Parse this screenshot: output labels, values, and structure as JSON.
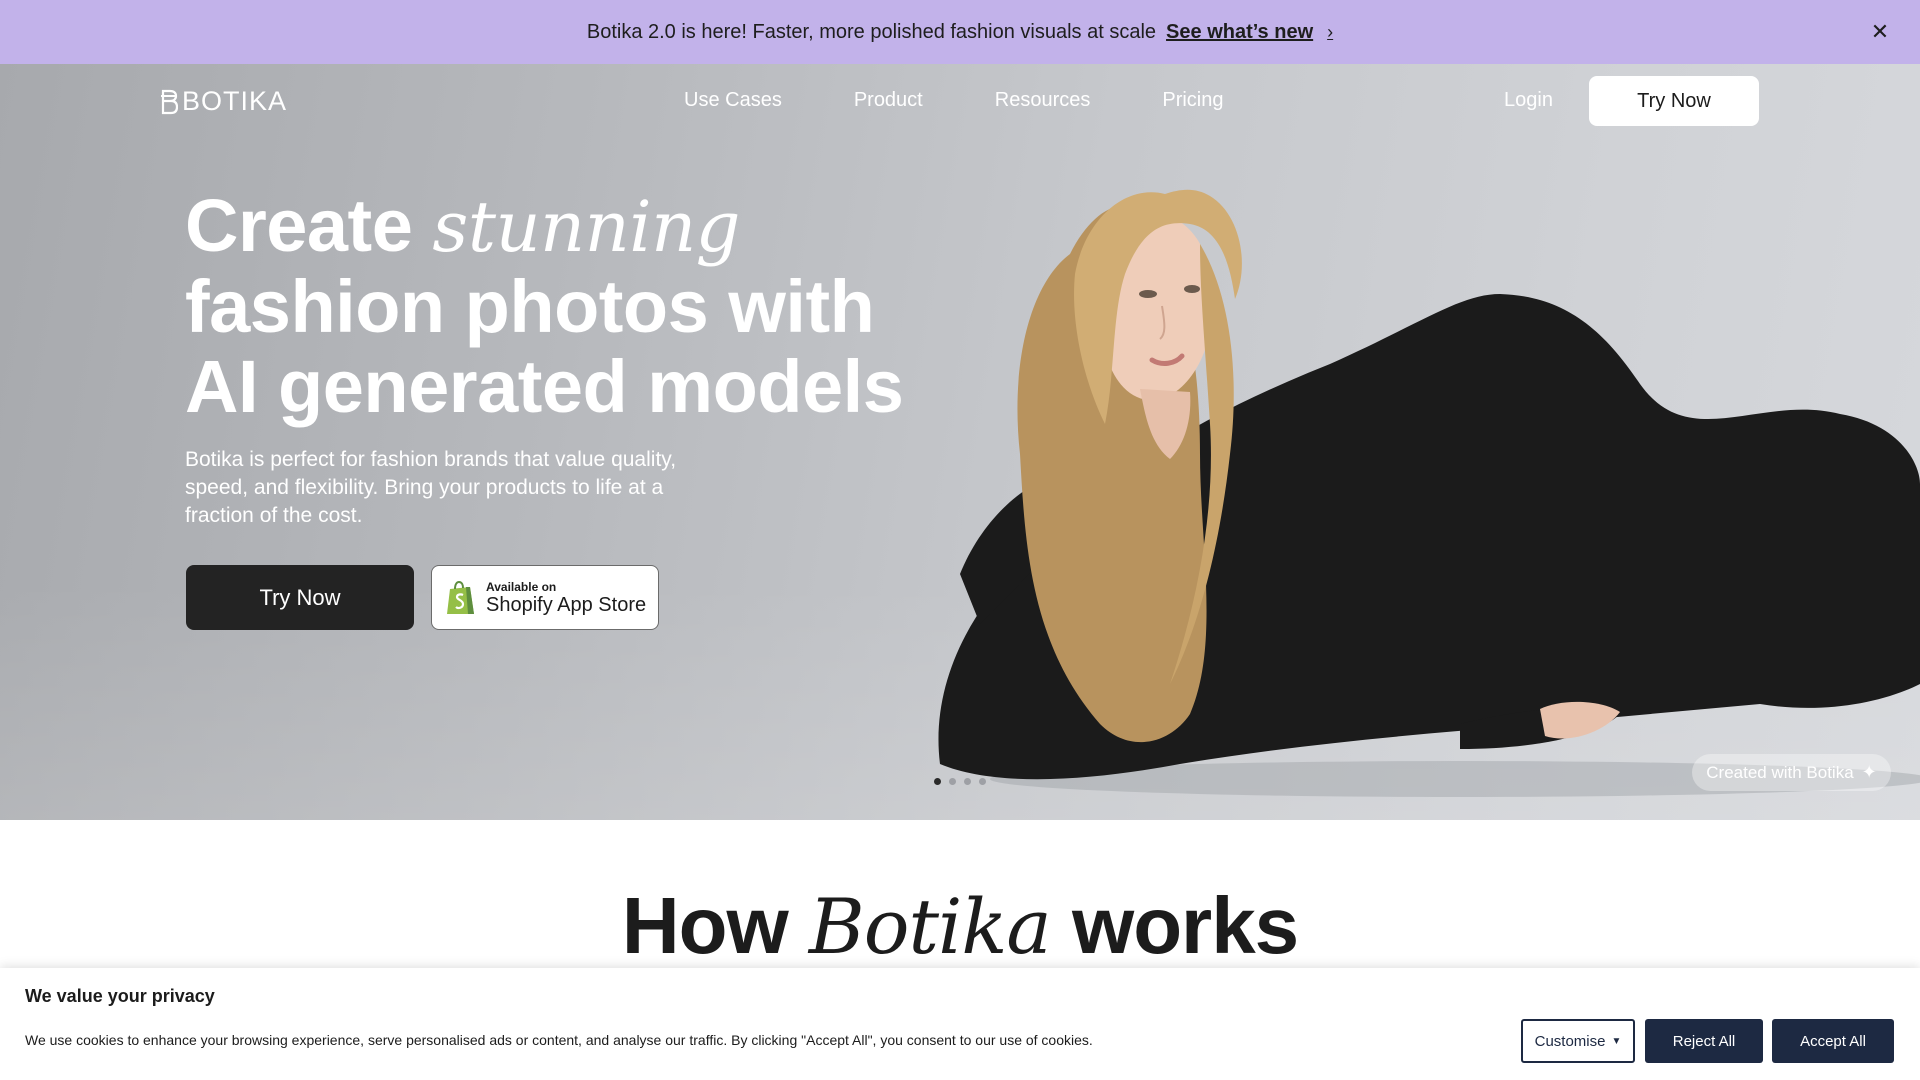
{
  "announcement": {
    "message": "Botika 2.0 is here! Faster, more polished fashion visuals at scale",
    "link_label": "See what’s new",
    "chevron_glyph": "›",
    "close_glyph": "✕"
  },
  "nav": {
    "logo_text": "BOTIKA",
    "links": [
      "Use Cases",
      "Product",
      "Resources",
      "Pricing"
    ],
    "login_label": "Login",
    "try_label": "Try Now"
  },
  "hero": {
    "headline_part1": "Create ",
    "headline_em": "stunning",
    "headline_line2": "fashion photos with",
    "headline_line3": "AI generated models",
    "subtext": "Botika is perfect for fashion brands that value quality, speed, and flexibility. Bring your products to life at a fraction of the cost.",
    "cta_try_label": "Try Now",
    "shopify_small": "Available on",
    "shopify_big": "Shopify App Store",
    "carousel": {
      "count": 4,
      "active": 0
    },
    "badge_text": "Created with Botika",
    "badge_icon": "sparkle-icon",
    "badge_glyph": "✦"
  },
  "section": {
    "title_part1": "How ",
    "title_em": "Botika",
    "title_part2": " works"
  },
  "cookie": {
    "title": "We value your privacy",
    "text": "We use cookies to enhance your browsing experience, serve personalised ads or content, and analyse our traffic. By clicking \"Accept All\", you consent to our use of cookies.",
    "customise_label": "Customise",
    "reject_label": "Reject All",
    "accept_label": "Accept All"
  },
  "colors": {
    "announcement_bg": "#c2b2ea",
    "dark_button": "#232323",
    "cookie_button": "#1d2942"
  }
}
